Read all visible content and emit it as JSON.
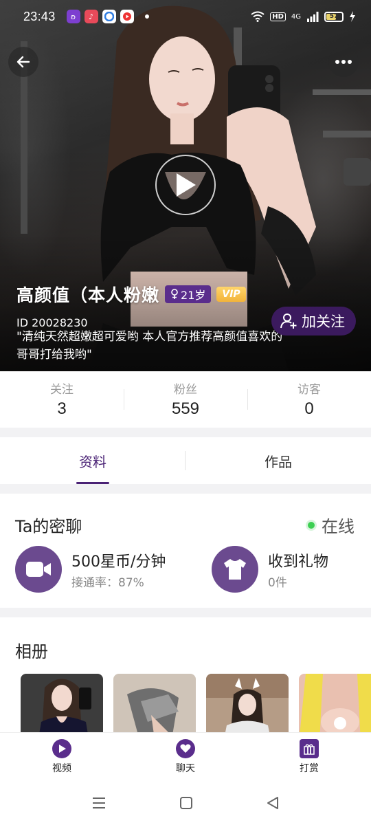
{
  "status_bar": {
    "time": "23:43",
    "network": "4G",
    "hd": "HD",
    "battery": "57",
    "battery_level": 0.57
  },
  "profile": {
    "name": "高颜值（本人粉嫩",
    "age": "21岁",
    "vip": "VIP",
    "id": "ID 20028230",
    "bio": "\"清纯天然超嫩超可爱哟 本人官方推荐高颜值喜欢的哥哥打给我哟\"",
    "follow_label": "加关注"
  },
  "stats": [
    {
      "label": "关注",
      "value": "3"
    },
    {
      "label": "粉丝",
      "value": "559"
    },
    {
      "label": "访客",
      "value": "0"
    }
  ],
  "tabs": [
    {
      "label": "资料",
      "active": true
    },
    {
      "label": "作品",
      "active": false
    }
  ],
  "private_chat": {
    "title": "Ta的密聊",
    "online_label": "在线",
    "price": "500星币/分钟",
    "connect_rate": "接通率：87%",
    "gifts_title": "收到礼物",
    "gifts_count": "0件"
  },
  "album": {
    "title": "相册"
  },
  "bottom_nav": [
    {
      "label": "视频",
      "icon": "play-icon"
    },
    {
      "label": "聊天",
      "icon": "heart-chat-icon"
    },
    {
      "label": "打赏",
      "icon": "gift-icon"
    }
  ],
  "colors": {
    "accent": "#4a2275",
    "icon_bg": "#6b4a8f",
    "online": "#3ccf52",
    "vip": "#f2b33a"
  }
}
